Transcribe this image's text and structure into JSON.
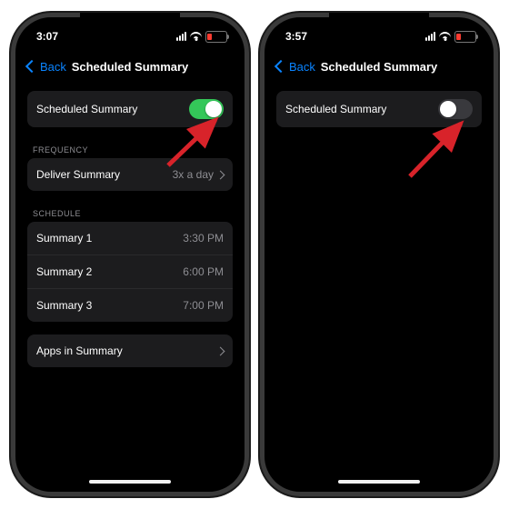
{
  "left": {
    "statusbar": {
      "time": "3:07"
    },
    "nav": {
      "back": "Back",
      "title": "Scheduled Summary"
    },
    "main_toggle": {
      "label": "Scheduled Summary",
      "on": true
    },
    "frequency": {
      "header": "FREQUENCY",
      "row_label": "Deliver Summary",
      "row_value": "3x a day"
    },
    "schedule": {
      "header": "SCHEDULE",
      "rows": [
        {
          "label": "Summary 1",
          "value": "3:30 PM"
        },
        {
          "label": "Summary 2",
          "value": "6:00 PM"
        },
        {
          "label": "Summary 3",
          "value": "7:00 PM"
        }
      ]
    },
    "apps_row": {
      "label": "Apps in Summary"
    }
  },
  "right": {
    "statusbar": {
      "time": "3:57"
    },
    "nav": {
      "back": "Back",
      "title": "Scheduled Summary"
    },
    "main_toggle": {
      "label": "Scheduled Summary",
      "on": false
    }
  },
  "colors": {
    "accent_green": "#34c759",
    "accent_blue": "#0a84ff",
    "arrow": "#d8232a"
  }
}
